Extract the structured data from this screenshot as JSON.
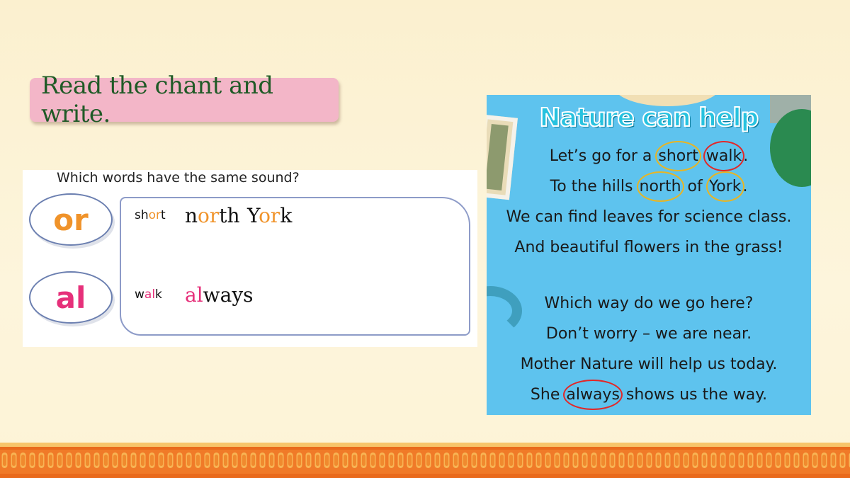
{
  "title": "Read the chant and write.",
  "worksheet": {
    "question": "Which words have the same sound?",
    "groups": [
      {
        "sound": "or",
        "key_word": {
          "before": "sh",
          "highlight": "or",
          "after": "t"
        },
        "answers": [
          {
            "before": "n",
            "highlight": "or",
            "after": "th"
          },
          {
            "before": "Y",
            "highlight": "or",
            "after": "k"
          }
        ]
      },
      {
        "sound": "al",
        "key_word": {
          "before": "w",
          "highlight": "al",
          "after": "k"
        },
        "answers": [
          {
            "before": "",
            "highlight": "al",
            "after": "ways"
          }
        ]
      }
    ]
  },
  "poem": {
    "title": "Nature can help",
    "lines": [
      {
        "pre": "Let’s go for a ",
        "c1": "short",
        "mid": " ",
        "c2": "walk",
        "post": "."
      },
      {
        "pre": "To the hills ",
        "c1": "north",
        "mid": " of ",
        "c2": "York",
        "post": "."
      },
      {
        "text": "We can find leaves for science class."
      },
      {
        "text": "And beautiful flowers in the grass!"
      },
      {
        "text": "Which way do we go here?"
      },
      {
        "text": "Don’t worry – we are near."
      },
      {
        "text": "Mother Nature will help us today."
      },
      {
        "pre": "She ",
        "c1": "always",
        "post": " shows us the way."
      }
    ]
  },
  "colors": {
    "or_sound": "#f0932a",
    "al_sound": "#e6307a",
    "title_text": "#1f5a26",
    "title_banner": "#f3b6c8",
    "poem_bg": "#5ec3ee",
    "circle_yellow": "#e8b524",
    "circle_red": "#e32727"
  }
}
